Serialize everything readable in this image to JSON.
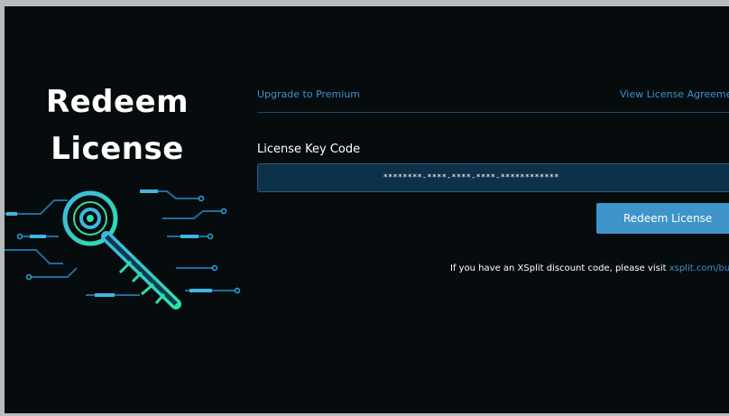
{
  "left_panel": {
    "title_line1": "Redeem",
    "title_line2": "License"
  },
  "top_links": {
    "upgrade": "Upgrade to Premium",
    "view_license": "View License Agreement"
  },
  "form": {
    "label": "License Key Code",
    "key_value": "********-****-****-****-************",
    "redeem_button": "Redeem License"
  },
  "discount": {
    "text": "If you have an XSplit discount code, please visit ",
    "link": "xsplit.com/buy"
  },
  "colors": {
    "background": "#060b0e",
    "accent": "#3f94c9",
    "link": "#3d93c9",
    "input_bg": "#0d3149"
  }
}
